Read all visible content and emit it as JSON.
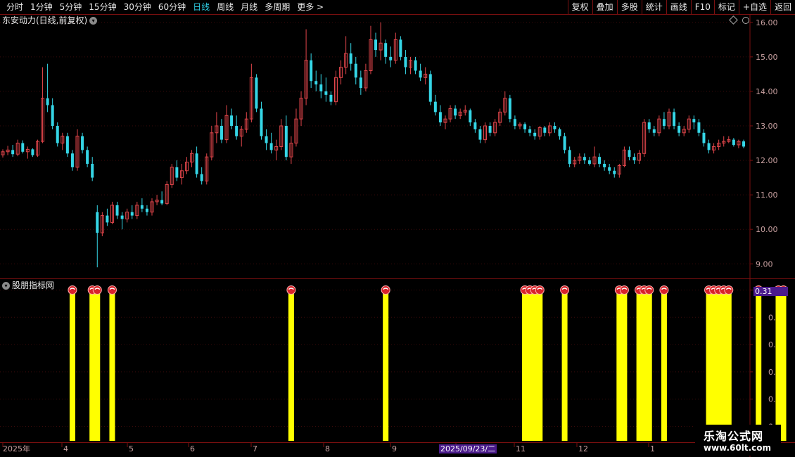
{
  "toolbar": {
    "periods": [
      "分时",
      "1分钟",
      "5分钟",
      "15分钟",
      "30分钟",
      "60分钟",
      "日线",
      "周线",
      "月线",
      "多周期",
      "更多 >"
    ],
    "active_period": "日线",
    "buttons": [
      "复权",
      "叠加",
      "多股",
      "统计",
      "画线",
      "F10",
      "标记",
      "+自选",
      "返回"
    ]
  },
  "main": {
    "title": "东安动力(日线,前复权)",
    "yticks": [
      "16.00",
      "15.00",
      "14.00",
      "13.00",
      "12.00",
      "11.00",
      "10.00",
      "9.00"
    ]
  },
  "sub": {
    "title": "股朋指标网",
    "value_badge": "0.31",
    "yticks": [
      "0.30",
      "0.25",
      "0.20",
      "0.15",
      "0.10",
      "0.05"
    ]
  },
  "xaxis": {
    "labels": [
      "2025年",
      "4",
      "5",
      "6",
      "7",
      "8",
      "9",
      "10",
      "11",
      "12",
      "1"
    ],
    "highlight_date": "2025/09/23/二"
  },
  "colors": {
    "up": "#e0454a",
    "down": "#35d6e6",
    "bar": "#ffff00",
    "grid": "#7a1010",
    "axis_text": "#c8a0a0"
  },
  "watermark": {
    "line1": "乐淘公式网",
    "line2": "www.60lt.com"
  },
  "chart_data": {
    "type": "candlestick",
    "price_range": [
      8.7,
      16.2
    ],
    "candles": [
      [
        12.16,
        12.32,
        12.08,
        12.25
      ],
      [
        12.25,
        12.42,
        12.15,
        12.3
      ],
      [
        12.3,
        12.45,
        12.1,
        12.18
      ],
      [
        12.18,
        12.6,
        12.12,
        12.5
      ],
      [
        12.5,
        12.58,
        12.2,
        12.25
      ],
      [
        12.25,
        12.4,
        12.05,
        12.32
      ],
      [
        12.32,
        12.35,
        12.1,
        12.15
      ],
      [
        12.15,
        12.6,
        12.1,
        12.55
      ],
      [
        12.55,
        14.7,
        12.5,
        13.8
      ],
      [
        13.8,
        14.8,
        13.4,
        13.6
      ],
      [
        13.6,
        13.8,
        12.9,
        13.0
      ],
      [
        13.0,
        13.1,
        12.4,
        12.5
      ],
      [
        12.5,
        12.8,
        12.3,
        12.7
      ],
      [
        12.7,
        12.8,
        12.1,
        12.2
      ],
      [
        12.2,
        12.3,
        11.7,
        11.8
      ],
      [
        11.8,
        12.9,
        11.7,
        12.7
      ],
      [
        12.7,
        12.8,
        12.2,
        12.3
      ],
      [
        12.3,
        12.4,
        11.8,
        11.9
      ],
      [
        11.9,
        12.1,
        11.4,
        11.5
      ],
      [
        10.5,
        10.7,
        8.9,
        9.9
      ],
      [
        9.9,
        10.5,
        9.8,
        10.4
      ],
      [
        10.4,
        10.6,
        10.1,
        10.2
      ],
      [
        10.2,
        10.8,
        10.15,
        10.7
      ],
      [
        10.7,
        10.8,
        10.3,
        10.4
      ],
      [
        10.4,
        10.5,
        10.0,
        10.3
      ],
      [
        10.3,
        10.6,
        10.2,
        10.5
      ],
      [
        10.5,
        10.7,
        10.3,
        10.4
      ],
      [
        10.4,
        10.8,
        10.3,
        10.7
      ],
      [
        10.7,
        10.9,
        10.5,
        10.6
      ],
      [
        10.6,
        10.7,
        10.4,
        10.5
      ],
      [
        10.5,
        10.9,
        10.4,
        10.8
      ],
      [
        10.8,
        11.0,
        10.7,
        10.85
      ],
      [
        10.85,
        11.1,
        10.7,
        10.75
      ],
      [
        10.75,
        11.4,
        10.7,
        11.3
      ],
      [
        11.3,
        11.9,
        11.2,
        11.8
      ],
      [
        11.8,
        12.0,
        11.4,
        11.5
      ],
      [
        11.5,
        11.9,
        11.3,
        11.7
      ],
      [
        11.7,
        12.1,
        11.6,
        11.95
      ],
      [
        11.95,
        12.3,
        11.8,
        12.2
      ],
      [
        12.2,
        12.4,
        11.5,
        11.6
      ],
      [
        11.6,
        11.8,
        11.3,
        11.4
      ],
      [
        11.4,
        12.2,
        11.3,
        12.1
      ],
      [
        12.1,
        13.0,
        12.0,
        12.8
      ],
      [
        12.8,
        13.4,
        12.5,
        13.0
      ],
      [
        13.0,
        13.2,
        12.5,
        12.6
      ],
      [
        12.6,
        13.6,
        12.5,
        13.3
      ],
      [
        13.3,
        13.5,
        12.9,
        13.0
      ],
      [
        13.0,
        13.3,
        12.6,
        12.7
      ],
      [
        12.7,
        13.0,
        12.4,
        12.9
      ],
      [
        12.9,
        13.4,
        12.8,
        13.2
      ],
      [
        13.2,
        14.8,
        13.1,
        14.4
      ],
      [
        14.4,
        14.5,
        13.4,
        13.5
      ],
      [
        13.5,
        13.7,
        12.6,
        12.7
      ],
      [
        12.7,
        12.9,
        12.3,
        12.5
      ],
      [
        12.5,
        12.8,
        12.2,
        12.3
      ],
      [
        12.3,
        12.6,
        12.0,
        12.4
      ],
      [
        12.4,
        13.2,
        12.3,
        13.0
      ],
      [
        13.0,
        13.3,
        12.0,
        12.1
      ],
      [
        12.1,
        12.7,
        11.9,
        12.5
      ],
      [
        12.5,
        13.5,
        12.4,
        13.2
      ],
      [
        13.2,
        14.0,
        13.0,
        13.8
      ],
      [
        13.8,
        15.8,
        13.6,
        14.9
      ],
      [
        14.9,
        15.1,
        14.1,
        14.3
      ],
      [
        14.3,
        14.6,
        14.0,
        14.2
      ],
      [
        14.2,
        14.5,
        13.8,
        14.0
      ],
      [
        14.0,
        14.4,
        13.7,
        13.9
      ],
      [
        13.9,
        14.0,
        13.6,
        13.7
      ],
      [
        13.7,
        14.6,
        13.6,
        14.4
      ],
      [
        14.4,
        14.9,
        14.2,
        14.7
      ],
      [
        14.7,
        15.6,
        14.5,
        15.1
      ],
      [
        15.1,
        15.4,
        14.6,
        14.8
      ],
      [
        14.8,
        15.0,
        14.2,
        14.4
      ],
      [
        14.4,
        14.6,
        13.9,
        14.1
      ],
      [
        14.1,
        14.8,
        14.0,
        14.6
      ],
      [
        14.6,
        15.9,
        14.5,
        15.5
      ],
      [
        15.5,
        15.7,
        15.0,
        15.2
      ],
      [
        15.2,
        16.0,
        14.9,
        15.4
      ],
      [
        15.4,
        15.5,
        14.8,
        15.0
      ],
      [
        15.0,
        15.3,
        14.7,
        14.9
      ],
      [
        14.9,
        15.7,
        14.8,
        15.5
      ],
      [
        15.5,
        15.6,
        14.9,
        15.0
      ],
      [
        15.0,
        15.2,
        14.5,
        14.7
      ],
      [
        14.7,
        15.0,
        14.5,
        14.9
      ],
      [
        14.9,
        15.0,
        14.5,
        14.6
      ],
      [
        14.6,
        14.8,
        14.3,
        14.4
      ],
      [
        14.4,
        14.7,
        14.2,
        14.5
      ],
      [
        14.5,
        14.6,
        13.6,
        13.7
      ],
      [
        13.7,
        13.9,
        13.3,
        13.4
      ],
      [
        13.4,
        13.6,
        13.0,
        13.1
      ],
      [
        13.1,
        13.3,
        12.9,
        13.2
      ],
      [
        13.2,
        13.6,
        13.1,
        13.5
      ],
      [
        13.5,
        13.6,
        13.2,
        13.3
      ],
      [
        13.3,
        13.5,
        13.2,
        13.4
      ],
      [
        13.4,
        13.6,
        13.3,
        13.45
      ],
      [
        13.45,
        13.5,
        13.0,
        13.1
      ],
      [
        13.1,
        13.2,
        12.8,
        12.9
      ],
      [
        12.9,
        13.0,
        12.5,
        12.6
      ],
      [
        12.6,
        13.1,
        12.5,
        13.0
      ],
      [
        13.0,
        13.1,
        12.7,
        12.8
      ],
      [
        12.8,
        13.2,
        12.7,
        13.1
      ],
      [
        13.1,
        13.5,
        13.0,
        13.4
      ],
      [
        13.4,
        14.0,
        13.3,
        13.8
      ],
      [
        13.8,
        13.9,
        13.1,
        13.2
      ],
      [
        13.2,
        13.3,
        12.9,
        13.0
      ],
      [
        13.0,
        13.1,
        12.9,
        13.05
      ],
      [
        13.05,
        13.1,
        12.8,
        12.9
      ],
      [
        12.9,
        13.0,
        12.7,
        12.8
      ],
      [
        12.8,
        12.9,
        12.6,
        12.7
      ],
      [
        12.7,
        13.0,
        12.6,
        12.95
      ],
      [
        12.95,
        13.0,
        12.7,
        12.8
      ],
      [
        12.8,
        13.1,
        12.7,
        13.0
      ],
      [
        13.0,
        13.1,
        12.8,
        12.9
      ],
      [
        12.9,
        12.95,
        12.6,
        12.7
      ],
      [
        12.7,
        12.8,
        12.2,
        12.3
      ],
      [
        12.3,
        12.4,
        11.8,
        11.9
      ],
      [
        11.9,
        12.1,
        11.8,
        12.0
      ],
      [
        12.0,
        12.2,
        11.9,
        12.1
      ],
      [
        12.1,
        12.2,
        11.9,
        12.0
      ],
      [
        12.0,
        12.1,
        11.85,
        11.9
      ],
      [
        11.9,
        12.4,
        11.8,
        12.1
      ],
      [
        12.1,
        12.2,
        11.8,
        11.9
      ],
      [
        11.9,
        12.0,
        11.7,
        11.8
      ],
      [
        11.8,
        11.9,
        11.6,
        11.7
      ],
      [
        11.7,
        11.8,
        11.5,
        11.6
      ],
      [
        11.6,
        11.9,
        11.5,
        11.85
      ],
      [
        11.85,
        12.4,
        11.8,
        12.3
      ],
      [
        12.3,
        12.4,
        12.0,
        12.1
      ],
      [
        12.1,
        12.2,
        11.9,
        12.0
      ],
      [
        12.0,
        12.3,
        11.9,
        12.2
      ],
      [
        12.2,
        13.2,
        12.1,
        13.1
      ],
      [
        13.1,
        13.2,
        12.8,
        12.9
      ],
      [
        12.9,
        13.0,
        12.7,
        12.8
      ],
      [
        12.8,
        13.3,
        12.7,
        13.2
      ],
      [
        13.2,
        13.4,
        12.9,
        13.0
      ],
      [
        13.0,
        13.5,
        12.9,
        13.4
      ],
      [
        13.4,
        13.5,
        12.9,
        13.0
      ],
      [
        13.0,
        13.1,
        12.7,
        12.8
      ],
      [
        12.8,
        13.0,
        12.7,
        12.9
      ],
      [
        12.9,
        13.3,
        12.8,
        13.2
      ],
      [
        13.2,
        13.3,
        12.9,
        13.1
      ],
      [
        13.1,
        13.2,
        12.7,
        12.8
      ],
      [
        12.8,
        12.9,
        12.4,
        12.5
      ],
      [
        12.5,
        12.6,
        12.2,
        12.3
      ],
      [
        12.3,
        12.5,
        12.2,
        12.4
      ],
      [
        12.4,
        12.6,
        12.3,
        12.5
      ],
      [
        12.5,
        12.7,
        12.4,
        12.55
      ],
      [
        12.55,
        12.7,
        12.5,
        12.6
      ],
      [
        12.6,
        12.65,
        12.4,
        12.45
      ],
      [
        12.45,
        12.6,
        12.35,
        12.55
      ],
      [
        12.55,
        12.6,
        12.35,
        12.4
      ]
    ],
    "signal_max": 0.3,
    "signal_candle_index": [
      14,
      18,
      19,
      22,
      58,
      77,
      105,
      106,
      107,
      108,
      113,
      124,
      125,
      128,
      129,
      130,
      133,
      142,
      143,
      144,
      145,
      146,
      152,
      156,
      157,
      193,
      194,
      196
    ]
  }
}
